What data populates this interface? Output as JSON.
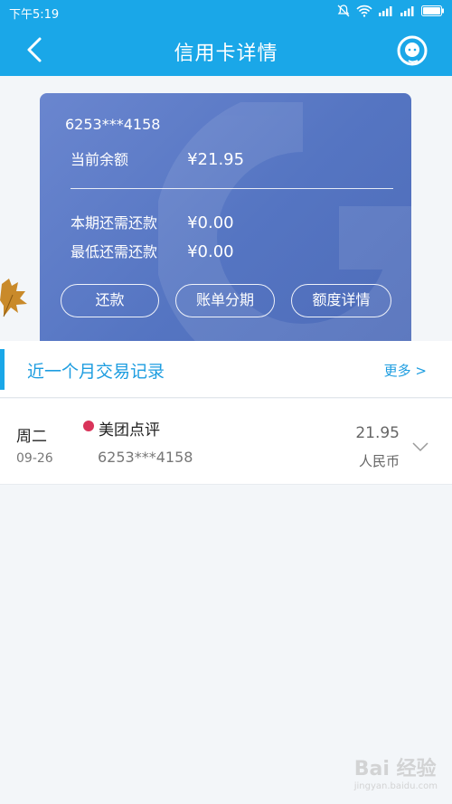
{
  "status": {
    "time": "下午5:19"
  },
  "header": {
    "title": "信用卡详情"
  },
  "card": {
    "number": "6253***4158",
    "balance_label": "当前余额",
    "balance_value": "¥21.95",
    "due_label": "本期还需还款",
    "due_value": "¥0.00",
    "min_label": "最低还需还款",
    "min_value": "¥0.00",
    "buttons": {
      "repay": "还款",
      "installment": "账单分期",
      "limit": "额度详情"
    }
  },
  "transactions": {
    "title": "近一个月交易记录",
    "more": "更多 >",
    "items": [
      {
        "day": "周二",
        "date": "09-26",
        "merchant": "美团点评",
        "card": "6253***4158",
        "amount": "21.95",
        "currency": "人民币"
      }
    ]
  },
  "watermark": {
    "text": "Bai 经验",
    "sub": "jingyan.baidu.com"
  },
  "colors": {
    "accent": "#1aa7e8",
    "card": "#5b78c6",
    "dot": "#d9345a"
  }
}
